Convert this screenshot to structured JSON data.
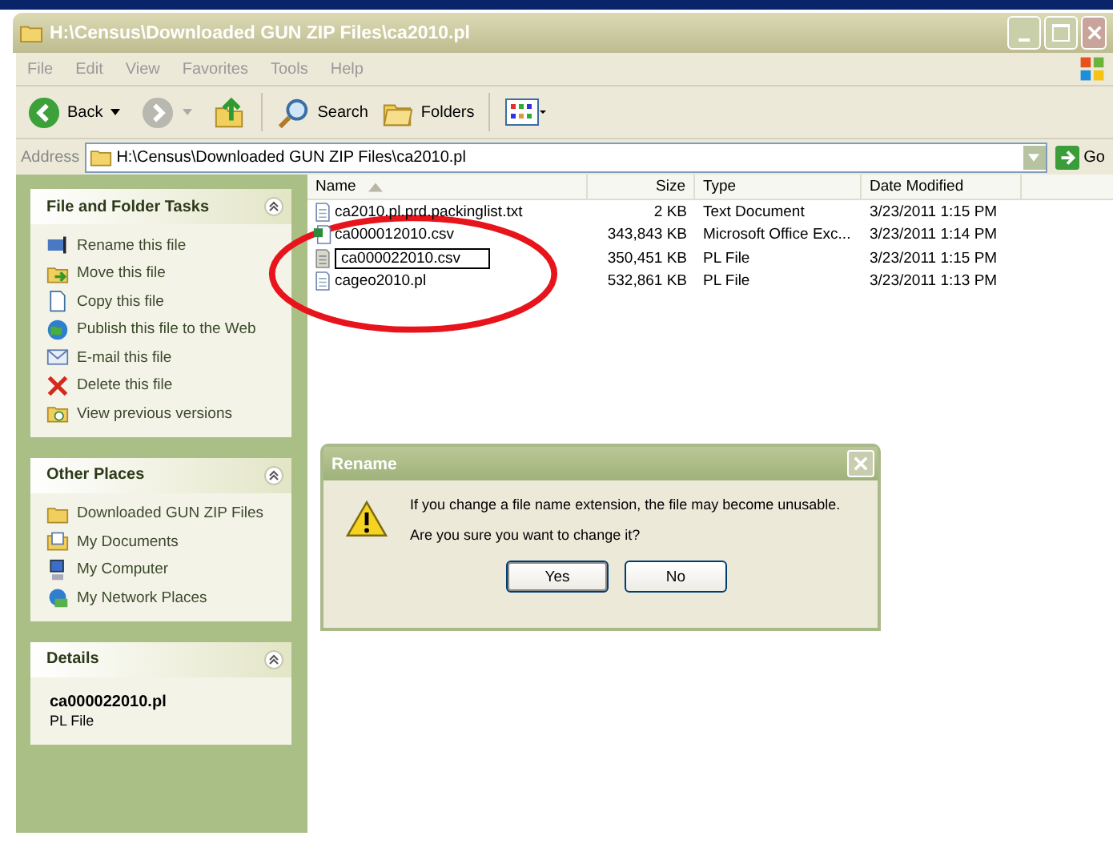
{
  "window": {
    "title": "H:\\Census\\Downloaded GUN ZIP Files\\ca2010.pl"
  },
  "menu": [
    "File",
    "Edit",
    "View",
    "Favorites",
    "Tools",
    "Help"
  ],
  "toolbar": [
    {
      "kind": "back",
      "label": "Back"
    },
    {
      "kind": "forward"
    },
    {
      "kind": "up"
    },
    {
      "kind": "search",
      "label": "Search"
    },
    {
      "kind": "folders",
      "label": "Folders"
    },
    {
      "kind": "views"
    }
  ],
  "address": {
    "label": "Address",
    "value": "H:\\Census\\Downloaded GUN ZIP Files\\ca2010.pl",
    "go": "Go"
  },
  "sidebar": [
    {
      "kind": "list",
      "title": "File and Folder Tasks",
      "items": [
        {
          "kind": "rename",
          "label": "Rename this file"
        },
        {
          "kind": "move",
          "label": "Move this file"
        },
        {
          "kind": "copy",
          "label": "Copy this file"
        },
        {
          "kind": "publish",
          "label": "Publish this file to the Web"
        },
        {
          "kind": "email",
          "label": "E-mail this file"
        },
        {
          "kind": "delete",
          "label": "Delete this file"
        },
        {
          "kind": "versions",
          "label": "View previous versions"
        }
      ]
    },
    {
      "kind": "list",
      "title": "Other Places",
      "items": [
        {
          "kind": "folder",
          "label": "Downloaded GUN ZIP Files"
        },
        {
          "kind": "documents",
          "label": "My Documents"
        },
        {
          "kind": "computer",
          "label": "My Computer"
        },
        {
          "kind": "network",
          "label": "My Network Places"
        }
      ]
    },
    {
      "kind": "details",
      "title": "Details",
      "name": "ca000022010.pl",
      "type": "PL File"
    }
  ],
  "table": {
    "columns": [
      {
        "label": "Name",
        "sorted": true
      },
      {
        "label": "Size",
        "sorted": false
      },
      {
        "label": "Type",
        "sorted": false
      },
      {
        "label": "Date Modified",
        "sorted": false
      }
    ],
    "rows": [
      {
        "kind": "text",
        "name": "ca2010.pl.prd.packinglist.txt",
        "size": "2 KB",
        "type": "Text Document",
        "date": "3/23/2011 1:15 PM",
        "editing": false
      },
      {
        "kind": "excel",
        "name": "ca000012010.csv",
        "size": "343,843 KB",
        "type": "Microsoft Office Exc...",
        "date": "3/23/2011 1:14 PM",
        "editing": false
      },
      {
        "kind": "pl",
        "name": "ca000022010.csv",
        "size": "350,451 KB",
        "type": "PL File",
        "date": "3/23/2011 1:15 PM",
        "editing": true
      },
      {
        "kind": "text",
        "name": "cageo2010.pl",
        "size": "532,861 KB",
        "type": "PL File",
        "date": "3/23/2011 1:13 PM",
        "editing": false
      }
    ]
  },
  "dialog": {
    "title": "Rename",
    "message": "If you change a file name extension, the file may become unusable.",
    "question": "Are you sure you want to change it?",
    "buttons": [
      {
        "label": "Yes",
        "selected": true
      },
      {
        "label": "No",
        "selected": false
      }
    ]
  },
  "annotation": {
    "kind": "ellipse"
  }
}
